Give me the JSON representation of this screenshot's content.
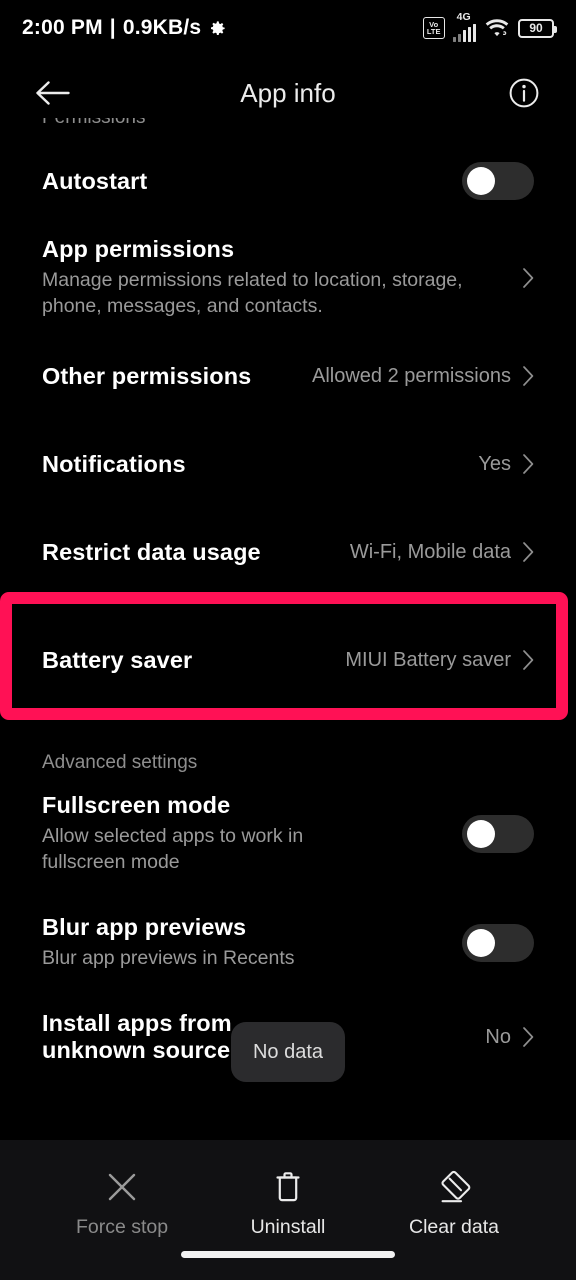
{
  "status_bar": {
    "time": "2:00 PM",
    "separator": "|",
    "network_speed": "0.9KB/s",
    "settings_icon": "gear-icon",
    "volte_top": "Vo",
    "volte_bottom": "LTE",
    "network_type": "4G",
    "battery_level": "90"
  },
  "app_bar": {
    "back_icon": "back-arrow-icon",
    "title": "App info",
    "info_icon": "info-circle-icon"
  },
  "sections": {
    "permissions_header": "Permissions",
    "advanced_header": "Advanced settings"
  },
  "rows": {
    "autostart": {
      "title": "Autostart",
      "toggle_state": "off"
    },
    "app_permissions": {
      "title": "App permissions",
      "subtitle": "Manage permissions related to location, storage, phone, messages, and contacts.",
      "chevron": "chevron-right-icon"
    },
    "other_permissions": {
      "title": "Other permissions",
      "value": "Allowed 2 permissions",
      "chevron": "chevron-right-icon"
    },
    "notifications": {
      "title": "Notifications",
      "value": "Yes",
      "chevron": "chevron-right-icon"
    },
    "restrict_data_usage": {
      "title": "Restrict data usage",
      "value": "Wi-Fi, Mobile data",
      "chevron": "chevron-right-icon"
    },
    "battery_saver": {
      "title": "Battery saver",
      "value": "MIUI Battery saver",
      "chevron": "chevron-right-icon",
      "highlighted": true,
      "highlight_color": "#ff1155"
    },
    "fullscreen_mode": {
      "title": "Fullscreen mode",
      "subtitle": "Allow selected apps to work in fullscreen mode",
      "toggle_state": "off"
    },
    "blur_app_previews": {
      "title": "Blur app previews",
      "subtitle": "Blur app previews in Recents",
      "toggle_state": "off"
    },
    "install_unknown_sources": {
      "title": "Install apps from unknown sources",
      "value": "No",
      "chevron": "chevron-right-icon"
    }
  },
  "toast": {
    "message": "No data"
  },
  "bottom_actions": [
    {
      "label": "Force stop",
      "icon": "close-x-icon",
      "enabled": false
    },
    {
      "label": "Uninstall",
      "icon": "trash-icon",
      "enabled": true
    },
    {
      "label": "Clear data",
      "icon": "eraser-icon",
      "enabled": true
    }
  ],
  "colors": {
    "background": "#000000",
    "accent_highlight": "#ff1155",
    "toggle_track": "#2d2d2d",
    "secondary_text": "#9a9a9a",
    "bottom_bar_bg": "#111113"
  }
}
